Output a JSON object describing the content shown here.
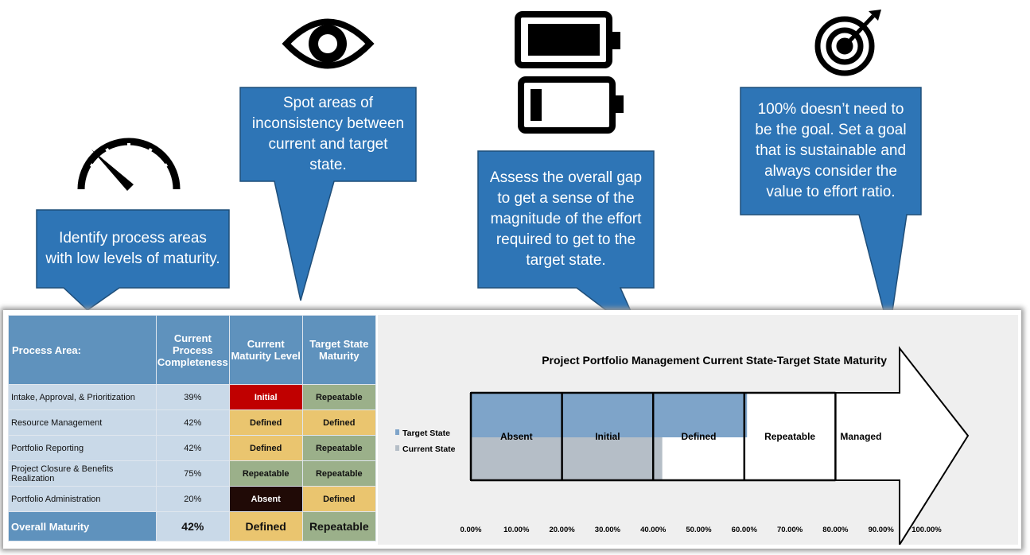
{
  "callouts": [
    {
      "text": "Identify process areas with low levels of maturity.",
      "icon": "speedometer-icon"
    },
    {
      "text": "Spot areas of inconsistency between current and target state.",
      "icon": "eye-icon"
    },
    {
      "text": "Assess the overall gap to get a sense of the magnitude of the effort required to get to the target state.",
      "icon": "battery-icon"
    },
    {
      "text": "100% doesn’t need to be the goal. Set a goal that is sustainable and always consider the value to effort ratio.",
      "icon": "target-icon"
    }
  ],
  "colors": {
    "callout": "#2e75b6",
    "header": "#5f92bd",
    "initial": "#c00000",
    "defined": "#eac56f",
    "repeatable": "#9bb08a",
    "absent": "#200a06",
    "target": "#7ea4c9",
    "current": "#b5bec7"
  },
  "table": {
    "headers": [
      "Process Area:",
      "Current Process Completeness",
      "Current Maturity Level",
      "Target State Maturity"
    ],
    "rows": [
      [
        "Intake, Approval, & Prioritization",
        "39%",
        "Initial",
        "Repeatable"
      ],
      [
        "Resource Management",
        "42%",
        "Defined",
        "Defined"
      ],
      [
        "Portfolio Reporting",
        "42%",
        "Defined",
        "Repeatable"
      ],
      [
        "Project Closure & Benefits Realization",
        "75%",
        "Repeatable",
        "Repeatable"
      ],
      [
        "Portfolio Administration",
        "20%",
        "Absent",
        "Defined"
      ]
    ],
    "overall": [
      "Overall Maturity",
      "42%",
      "Defined",
      "Repeatable"
    ]
  },
  "chart_data": {
    "type": "bar",
    "title": "Project Portfolio Management Current State-Target State Maturity",
    "series": [
      {
        "name": "Target State",
        "value": 60.6,
        "color": "#7ea4c9"
      },
      {
        "name": "Current State",
        "value": 42,
        "color": "#b5bec7"
      }
    ],
    "stages": [
      "Absent",
      "Initial",
      "Defined",
      "Repeatable",
      "Managed"
    ],
    "xlim": [
      0,
      100
    ],
    "ticks": [
      "0.00%",
      "10.00%",
      "20.00%",
      "30.00%",
      "40.00%",
      "50.00%",
      "60.00%",
      "70.00%",
      "80.00%",
      "90.00%",
      "100.00%"
    ],
    "legend": "left"
  }
}
